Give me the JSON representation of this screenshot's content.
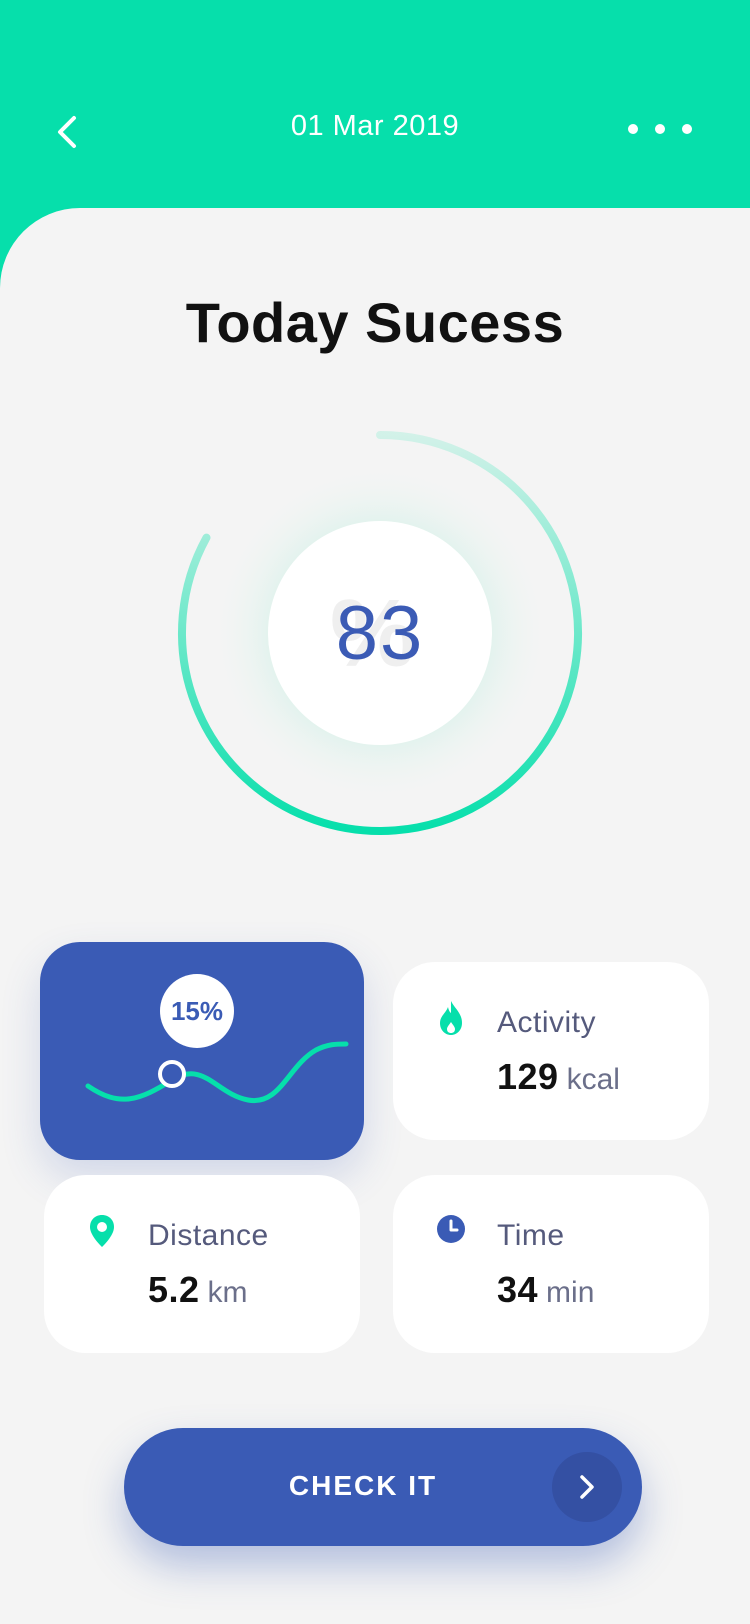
{
  "header": {
    "date": "01 Mar 2019",
    "back_icon": "chevron-left-icon",
    "more_icon": "more-dots-icon"
  },
  "main": {
    "title": "Today Sucess",
    "score": "83",
    "score_ghost": "%",
    "progress_fraction": 0.83
  },
  "cards": {
    "trend": {
      "percent": "15%"
    },
    "activity": {
      "icon": "flame-icon",
      "label": "Activity",
      "value": "129",
      "unit": "kcal"
    },
    "distance": {
      "icon": "location-pin-icon",
      "label": "Distance",
      "value": "5.2",
      "unit": "km"
    },
    "time": {
      "icon": "clock-icon",
      "label": "Time",
      "value": "34",
      "unit": "min"
    }
  },
  "cta": {
    "label": "CHECK IT",
    "arrow_icon": "chevron-right-icon"
  },
  "colors": {
    "accent_green": "#06dfab",
    "brand_blue": "#3a5bb5",
    "background": "#f4f4f4"
  }
}
